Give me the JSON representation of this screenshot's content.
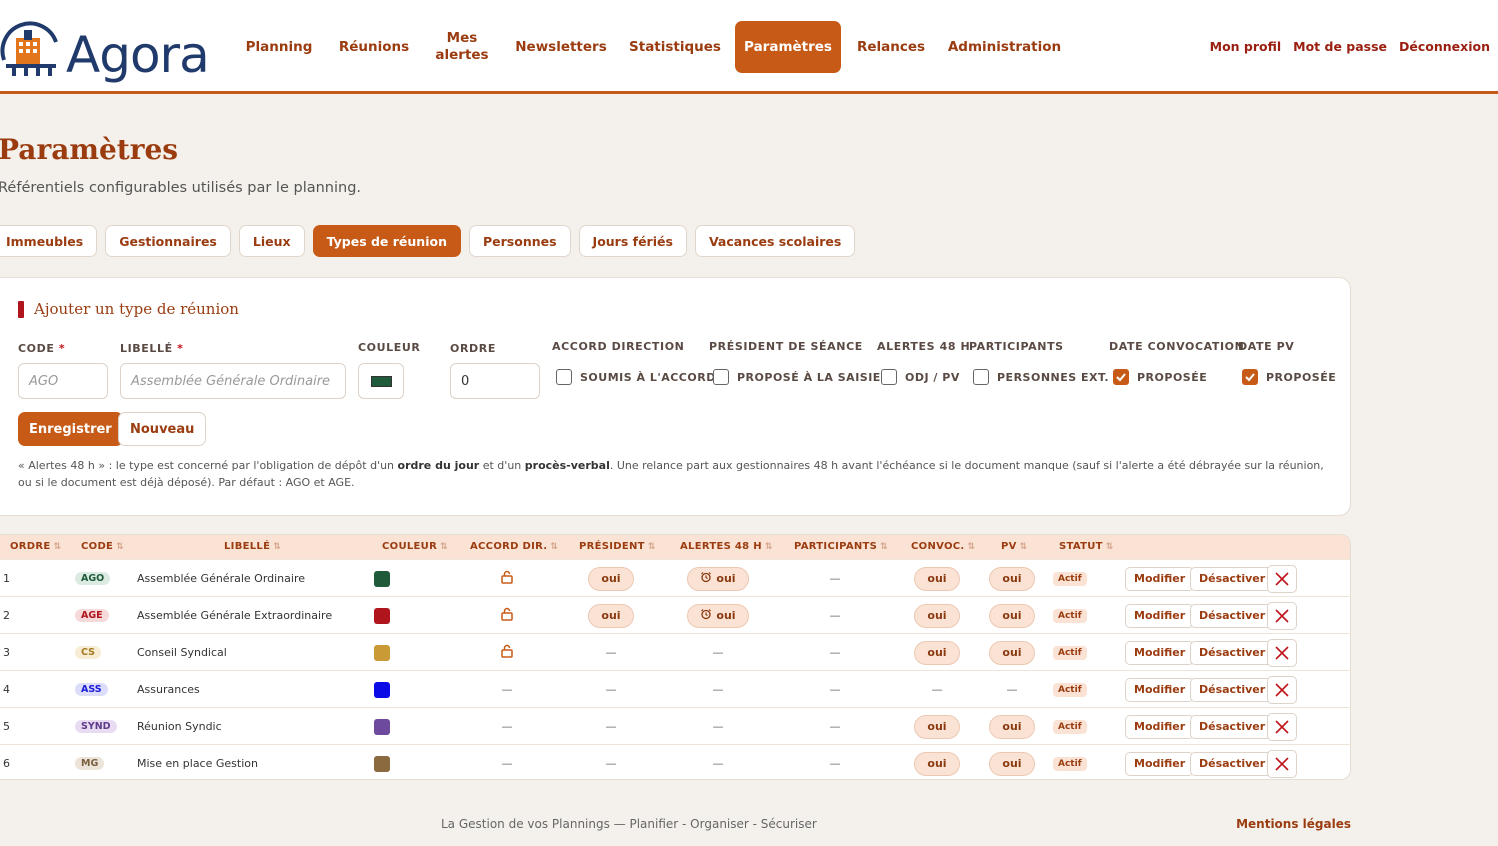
{
  "header": {
    "brand": "Agora",
    "nav": [
      {
        "label": "Planning",
        "active": false
      },
      {
        "label": "Réunions",
        "active": false
      },
      {
        "label": "Mes alertes",
        "active": false
      },
      {
        "label": "Newsletters",
        "active": false
      },
      {
        "label": "Statistiques",
        "active": false
      },
      {
        "label": "Paramètres",
        "active": true
      },
      {
        "label": "Relances",
        "active": false
      },
      {
        "label": "Administration",
        "active": false
      }
    ],
    "user_links": [
      "Mon profil",
      "Mot de passe",
      "Déconnexion"
    ]
  },
  "page": {
    "title": "Paramètres",
    "subtitle": "Référentiels configurables utilisés par le planning.",
    "tabs": [
      {
        "label": "Immeubles",
        "active": false
      },
      {
        "label": "Gestionnaires",
        "active": false
      },
      {
        "label": "Lieux",
        "active": false
      },
      {
        "label": "Types de réunion",
        "active": true
      },
      {
        "label": "Personnes",
        "active": false
      },
      {
        "label": "Jours fériés",
        "active": false
      },
      {
        "label": "Vacances scolaires",
        "active": false
      }
    ]
  },
  "form": {
    "title": "Ajouter un type de réunion",
    "code_label": "CODE",
    "code_placeholder": "AGO",
    "libelle_label": "LIBELLÉ",
    "libelle_placeholder": "Assemblée Générale Ordinaire",
    "required_mark": "*",
    "couleur_label": "COULEUR",
    "couleur_value": "#1f5a3a",
    "ordre_label": "ORDRE",
    "ordre_value": "0",
    "accord_label": "ACCORD DIRECTION",
    "accord_check": "SOUMIS À L'ACCORD",
    "accord_checked": false,
    "president_label": "PRÉSIDENT DE SÉANCE",
    "president_check": "PROPOSÉ À LA SAISIE",
    "president_checked": false,
    "alertes_label": "ALERTES 48 H",
    "alertes_check": "ODJ / PV",
    "alertes_checked": false,
    "participants_label": "PARTICIPANTS",
    "participants_check": "PERSONNES EXT.",
    "participants_checked": false,
    "convoc_label": "DATE CONVOCATION",
    "convoc_check": "PROPOSÉE",
    "convoc_checked": true,
    "pv_label": "DATE PV",
    "pv_check": "PROPOSÉE",
    "pv_checked": true,
    "save_label": "Enregistrer",
    "new_label": "Nouveau",
    "note_a": "« Alertes 48 h » : le type est concerné par l'obligation de dépôt d'un ",
    "note_b": "ordre du jour",
    "note_c": " et d'un ",
    "note_d": "procès-verbal",
    "note_e": ". Une relance part aux gestionnaires 48 h avant l'échéance si le document manque (sauf si l'alerte a été débrayée sur la réunion, ou si le document est déjà déposé). Par défaut : AGO et AGE."
  },
  "table": {
    "columns": [
      "ORDRE",
      "CODE",
      "LIBELLÉ",
      "COULEUR",
      "ACCORD DIR.",
      "PRÉSIDENT",
      "ALERTES 48 H",
      "PARTICIPANTS",
      "CONVOC.",
      "PV",
      "STATUT"
    ],
    "sort_glyph": "⇅",
    "yes": "oui",
    "dash": "—",
    "modify_label": "Modifier",
    "deactivate_label": "Désactiver",
    "rows": [
      {
        "ordre": "1",
        "code": "AGO",
        "code_bg": "#dcebe1",
        "code_fg": "#1f5a3a",
        "libelle": "Assemblée Générale Ordinaire",
        "couleur": "#1f5a3a",
        "accord": true,
        "president": true,
        "alertes": true,
        "participants": false,
        "convoc": true,
        "pv": true,
        "statut": "Actif"
      },
      {
        "ordre": "2",
        "code": "AGE",
        "code_bg": "#f6dada",
        "code_fg": "#b0141d",
        "libelle": "Assemblée Générale Extraordinaire",
        "couleur": "#b0141d",
        "accord": true,
        "president": true,
        "alertes": true,
        "participants": false,
        "convoc": true,
        "pv": true,
        "statut": "Actif"
      },
      {
        "ordre": "3",
        "code": "CS",
        "code_bg": "#f7ecd4",
        "code_fg": "#a57a20",
        "libelle": "Conseil Syndical",
        "couleur": "#c99a35",
        "accord": true,
        "president": false,
        "alertes": false,
        "participants": false,
        "convoc": true,
        "pv": true,
        "statut": "Actif"
      },
      {
        "ordre": "4",
        "code": "ASS",
        "code_bg": "#dcdcfb",
        "code_fg": "#1a1ad8",
        "libelle": "Assurances",
        "couleur": "#0b0be8",
        "accord": false,
        "president": false,
        "alertes": false,
        "participants": false,
        "convoc": false,
        "pv": false,
        "statut": "Actif"
      },
      {
        "ordre": "5",
        "code": "SYND",
        "code_bg": "#e8dcf3",
        "code_fg": "#5e3a8a",
        "libelle": "Réunion Syndic",
        "couleur": "#6e4a9e",
        "accord": false,
        "president": false,
        "alertes": false,
        "participants": false,
        "convoc": true,
        "pv": true,
        "statut": "Actif"
      },
      {
        "ordre": "6",
        "code": "MG",
        "code_bg": "#ece4d8",
        "code_fg": "#7a6040",
        "libelle": "Mise en place Gestion",
        "couleur": "#8a6a3e",
        "accord": false,
        "president": false,
        "alertes": false,
        "participants": false,
        "convoc": true,
        "pv": true,
        "statut": "Actif"
      }
    ]
  },
  "footer": {
    "tagline": "La Gestion de vos Plannings — Planifier - Organiser - Sécuriser",
    "legal": "Mentions légales"
  }
}
